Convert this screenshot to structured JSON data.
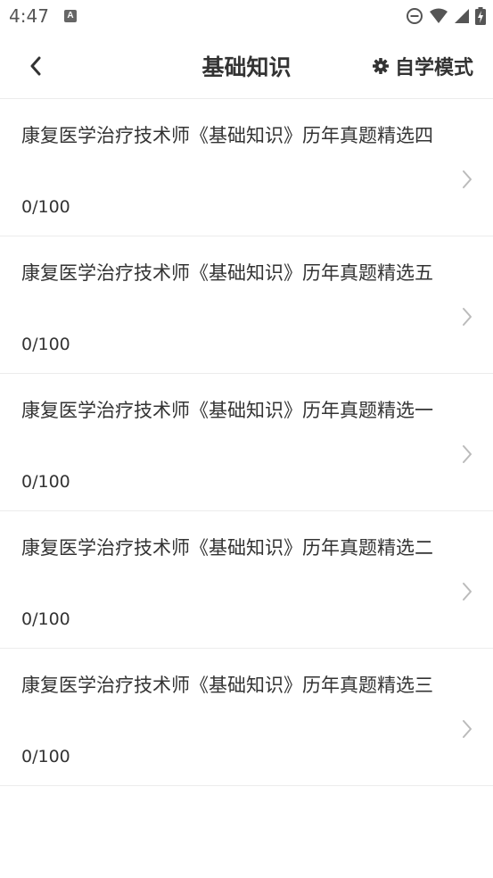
{
  "status_bar": {
    "time": "4:47",
    "notification_icon": "A"
  },
  "header": {
    "title": "基础知识",
    "mode_label": "自学模式"
  },
  "items": [
    {
      "title": "康复医学治疗技术师《基础知识》历年真题精选四",
      "progress": "0/100"
    },
    {
      "title": "康复医学治疗技术师《基础知识》历年真题精选五",
      "progress": "0/100"
    },
    {
      "title": "康复医学治疗技术师《基础知识》历年真题精选一",
      "progress": "0/100"
    },
    {
      "title": "康复医学治疗技术师《基础知识》历年真题精选二",
      "progress": "0/100"
    },
    {
      "title": "康复医学治疗技术师《基础知识》历年真题精选三",
      "progress": "0/100"
    }
  ],
  "colors": {
    "text": "#333333",
    "divider": "#ececec",
    "chevron": "#bbbbbb"
  }
}
